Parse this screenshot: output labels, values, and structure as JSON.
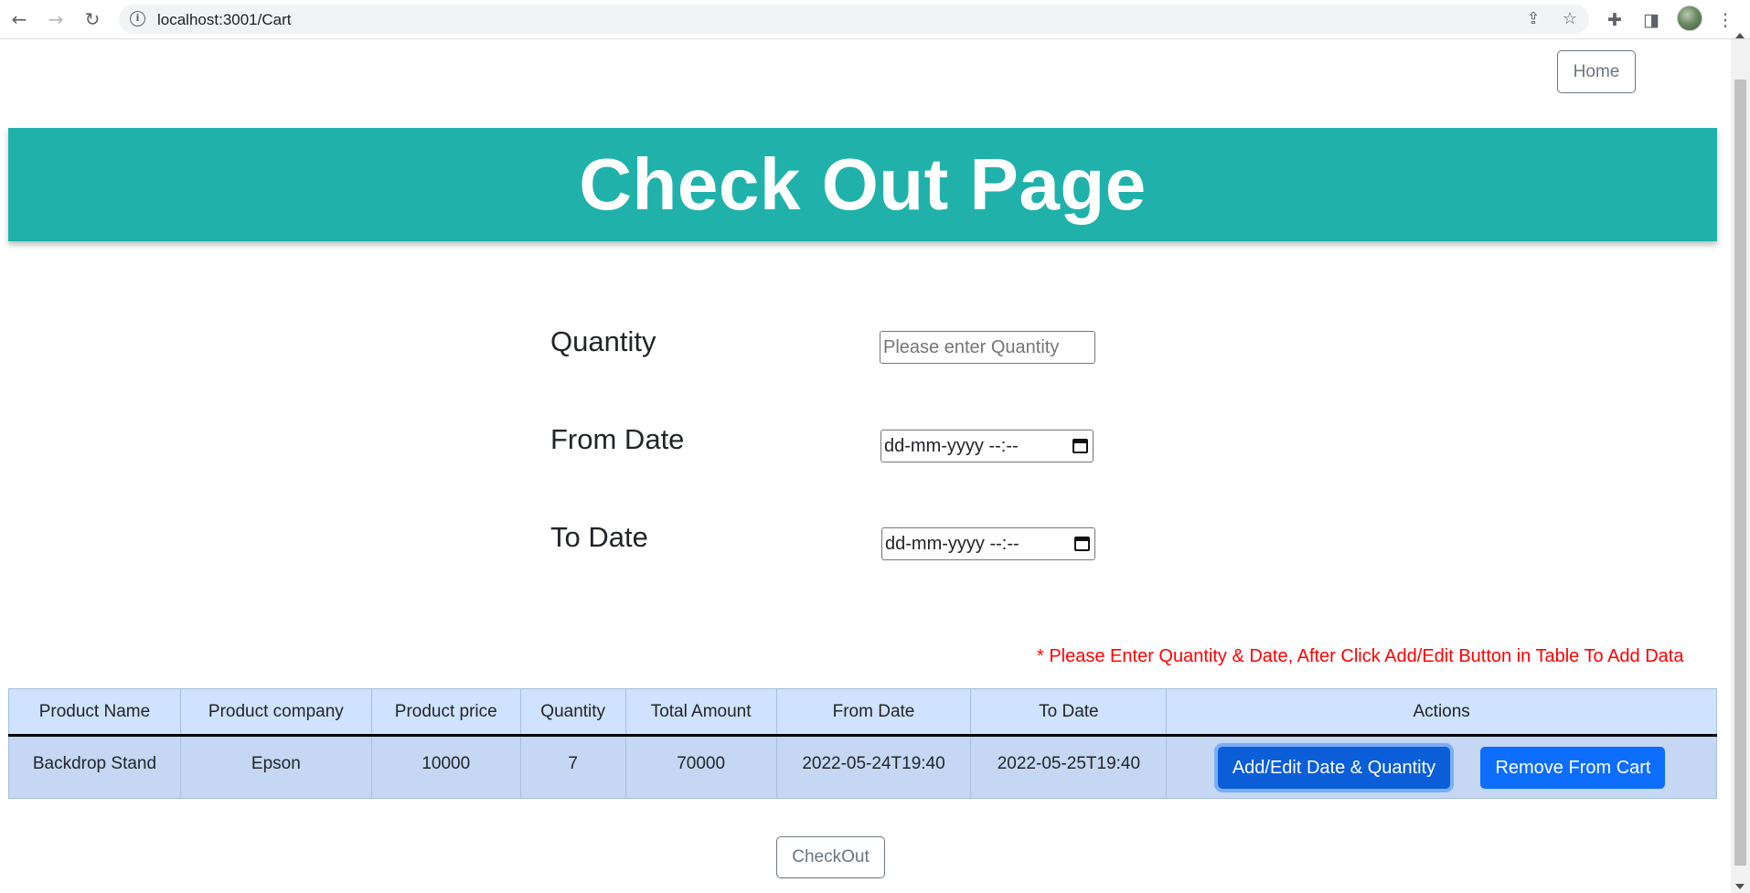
{
  "browser": {
    "url": "localhost:3001/Cart",
    "icons": {
      "back": "arrow-left-icon",
      "forward": "arrow-right-icon",
      "reload": "reload-icon",
      "info": "info-icon",
      "share": "share-icon",
      "bookmark": "star-icon",
      "extensions": "puzzle-icon",
      "sidepanel": "side-panel-icon",
      "menu": "kebab-menu-icon"
    }
  },
  "nav": {
    "home_label": "Home"
  },
  "banner": {
    "title": "Check Out Page",
    "color": "#20b2aa"
  },
  "form": {
    "quantity_label": "Quantity",
    "quantity_placeholder": "Please enter Quantity",
    "from_label": "From Date",
    "from_value": "dd-mm-yyyy --:--",
    "to_label": "To Date",
    "to_value": "dd-mm-yyyy --:--"
  },
  "hint": "* Please Enter Quantity & Date, After Click Add/Edit Button in Table To Add Data",
  "table": {
    "headers": [
      "Product Name",
      "Product company",
      "Product price",
      "Quantity",
      "Total Amount",
      "From Date",
      "To Date",
      "Actions"
    ],
    "rows": [
      {
        "product_name": "Backdrop Stand",
        "company": "Epson",
        "price": "10000",
        "quantity": "7",
        "total": "70000",
        "from_date": "2022-05-24T19:40",
        "to_date": "2022-05-25T19:40",
        "edit_label": "Add/Edit Date & Quantity",
        "remove_label": "Remove From Cart"
      }
    ]
  },
  "checkout_label": "CheckOut",
  "colors": {
    "primary": "#0d6efd",
    "hint": "#ff0000",
    "table_header": "#cfe2ff",
    "table_row": "#c5d7f2"
  }
}
